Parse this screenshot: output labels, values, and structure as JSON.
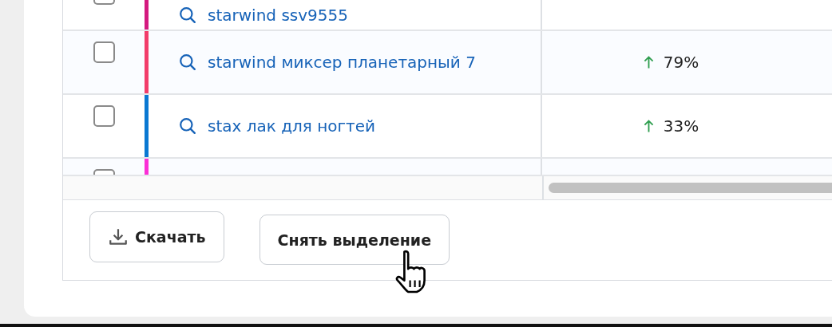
{
  "table": {
    "rows": [
      {
        "checked": false,
        "color": "#d4197f",
        "query": "starwind ssv9555"
      },
      {
        "checked": false,
        "color": "#f23d6a",
        "query": "starwind миксер планетарный 7",
        "change": "79%",
        "rising": true
      },
      {
        "checked": false,
        "color": "#0a78d2",
        "query": "stax лак для ногтей",
        "change": "33%",
        "rising": true
      },
      {
        "checked": false,
        "color": "#fb2fd6"
      }
    ]
  },
  "buttons": [
    {
      "kind": "download",
      "label": "Скачать"
    },
    {
      "kind": "plain",
      "label": "Снять выделение"
    }
  ]
}
